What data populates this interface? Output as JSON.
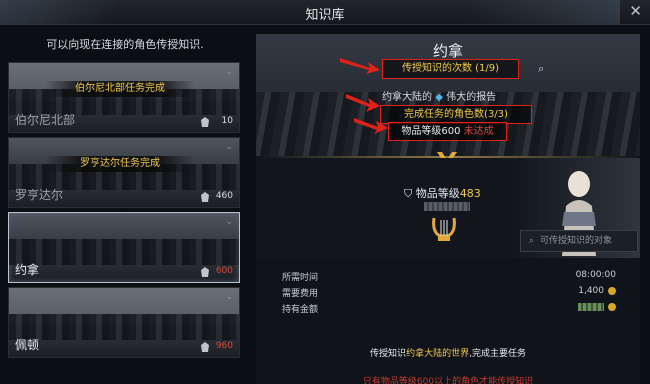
{
  "window": {
    "title": "知识库",
    "close": "✕"
  },
  "left_header": "可以向现在连接的角色传授知识.",
  "regions": [
    {
      "name": "伯尔尼北部",
      "banner": "伯尔尼北部任务完成",
      "level": "10",
      "level_color": "#d7dbe0"
    },
    {
      "name": "罗亨达尔",
      "banner": "罗亨达尔任务完成",
      "level": "460",
      "level_color": "#d7dbe0"
    },
    {
      "name": "约拿",
      "banner": "",
      "level": "600",
      "level_color": "#d14a3c"
    },
    {
      "name": "佩顿",
      "banner": "",
      "level": "960",
      "level_color": "#d14a3c"
    }
  ],
  "detail": {
    "region_name": "约拿",
    "times": "传授知识的次数 (1/9)",
    "report_prefix": "约拿大陆的",
    "report_suffix": "伟大的报告",
    "completed": "完成任务的角色数(3/3)",
    "req_label": "物品等级600",
    "req_status": "未达成",
    "item_level_label": "物品等级",
    "item_level_value": "483",
    "target_placeholder": "可传授知识的对象"
  },
  "info": {
    "time_label": "所需时间",
    "time_value": "08:00:00",
    "cost_label": "需要费用",
    "cost_value": "1,400",
    "gold_label": "持有金额"
  },
  "footer": {
    "prefix": "传授知识",
    "highlight": "约拿大陆的世界",
    "suffix": ",完成主要任务",
    "warning": "只有物品等级600以上的角色才能传授知识"
  },
  "colors": {
    "accent_gold": "#f0c94a",
    "alert_red": "#d14a3c",
    "frame_red": "#e0221b"
  }
}
